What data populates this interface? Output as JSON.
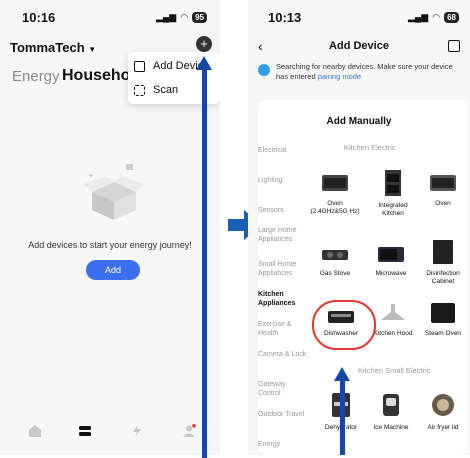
{
  "left": {
    "time": "10:16",
    "battery": "95",
    "brand": "TommaTech",
    "tabs": [
      "Energy",
      "Household"
    ],
    "menu": [
      {
        "label": "Add Device",
        "icon": "add-device-icon"
      },
      {
        "label": "Scan",
        "icon": "scan-icon"
      }
    ],
    "empty_message": "Add devices to start your energy journey!",
    "add_button": "Add",
    "nav": [
      "home-icon",
      "devices-icon",
      "energy-icon",
      "profile-icon"
    ]
  },
  "right": {
    "time": "10:13",
    "battery": "68",
    "title": "Add Device",
    "searching_text": "Searching for nearby devices. Make sure your device has entered",
    "pairing_link": "pairing mode",
    "add_manually": "Add Manually",
    "categories": [
      "Electrical",
      "Lighting",
      "Sensors",
      "Large Home Appliances",
      "Small Home Appliances",
      "Kitchen Appliances",
      "Exercise & Health",
      "Camera & Lock",
      "Gateway Control",
      "Outdoor Travel",
      "Energy"
    ],
    "active_category": "Kitchen Appliances",
    "section_kitchen_electric": "Kitchen Electric",
    "section_kitchen_small": "Kitchen Small Electric",
    "devices": [
      {
        "name": "Oven (2.4GHz&5G Hz)"
      },
      {
        "name": "Integrated Kitchen"
      },
      {
        "name": "Oven"
      },
      {
        "name": "Gas Stove"
      },
      {
        "name": "Microwave"
      },
      {
        "name": "Disinfection Cabinet"
      },
      {
        "name": "Dishwasher"
      },
      {
        "name": "Kitchen Hood"
      },
      {
        "name": "Steam Oven"
      },
      {
        "name": "Dehydrator"
      },
      {
        "name": "Ice Machine"
      },
      {
        "name": "Air fryer lid"
      }
    ]
  },
  "colors": {
    "accent": "#3c6ff0",
    "annotation_arrow": "#1448a8",
    "highlight": "#e53935"
  }
}
